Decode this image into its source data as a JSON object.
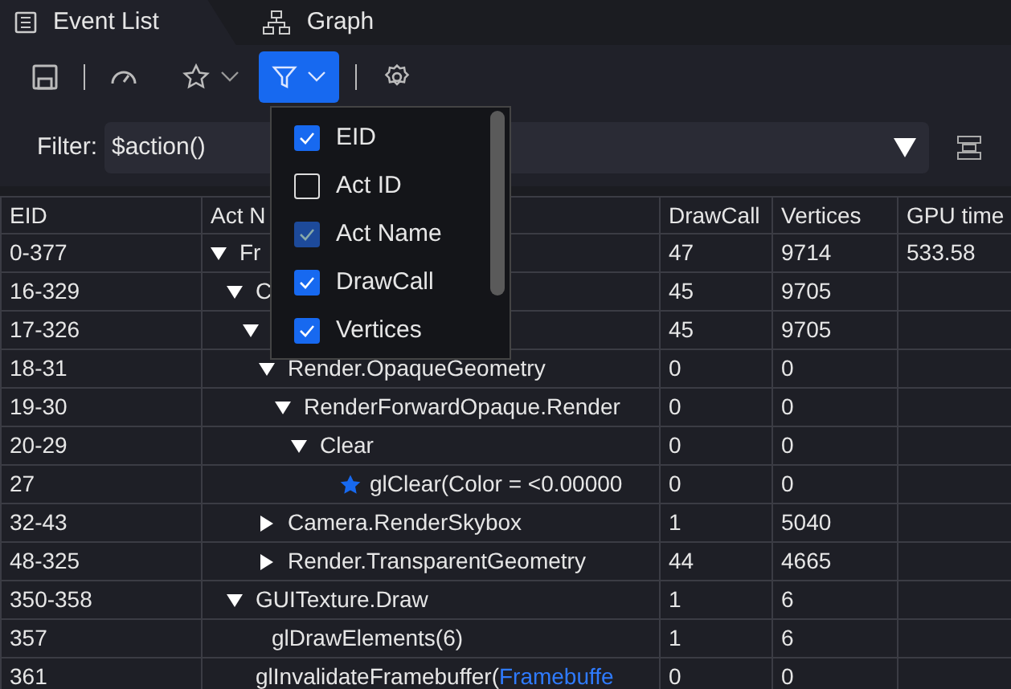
{
  "tabs": [
    {
      "label": "Event List",
      "selected": true
    },
    {
      "label": "Graph",
      "selected": false
    }
  ],
  "toolbar": {
    "filter_button": {
      "selected": true
    }
  },
  "filter": {
    "label": "Filter:",
    "value": "$action()"
  },
  "column_menu": {
    "items": [
      {
        "label": "EID",
        "checked": true,
        "disabled": false
      },
      {
        "label": "Act ID",
        "checked": false,
        "disabled": false
      },
      {
        "label": "Act Name",
        "checked": true,
        "disabled": true
      },
      {
        "label": "DrawCall",
        "checked": true,
        "disabled": false
      },
      {
        "label": "Vertices",
        "checked": true,
        "disabled": false
      }
    ]
  },
  "table": {
    "columns": [
      "EID",
      "Act N",
      "DrawCall",
      "Vertices",
      "GPU time"
    ],
    "rows": [
      {
        "eid": "0-377",
        "name": "Fr",
        "drawcall": "47",
        "vertices": "9714",
        "gpu_time": "533.58",
        "expanded": true,
        "bookmarked": false,
        "children": [
          {
            "eid": "16-329",
            "name": "C",
            "drawcall": "45",
            "vertices": "9705",
            "expanded": true,
            "bookmarked": false,
            "children": [
              {
                "eid": "17-326",
                "drawcall": "45",
                "vertices": "9705",
                "expanded": true,
                "bookmarked": false,
                "children": [
                  {
                    "eid": "18-31",
                    "name": "Render.OpaqueGeometry",
                    "drawcall": "0",
                    "vertices": "0",
                    "expanded": true,
                    "bookmarked": false,
                    "children": [
                      {
                        "eid": "19-30",
                        "name": "RenderForwardOpaque.Render",
                        "drawcall": "0",
                        "vertices": "0",
                        "expanded": true,
                        "bookmarked": false,
                        "children": [
                          {
                            "eid": "20-29",
                            "name": "Clear",
                            "drawcall": "0",
                            "vertices": "0",
                            "expanded": true,
                            "bookmarked": false,
                            "children": [
                              {
                                "eid": "27",
                                "name": "glClear(Color = <0.00000",
                                "drawcall": "0",
                                "vertices": "0",
                                "bookmarked": true
                              }
                            ]
                          }
                        ]
                      }
                    ]
                  },
                  {
                    "eid": "32-43",
                    "name": "Camera.RenderSkybox",
                    "drawcall": "1",
                    "vertices": "5040",
                    "expanded": false,
                    "bookmarked": false
                  },
                  {
                    "eid": "48-325",
                    "name": "Render.TransparentGeometry",
                    "drawcall": "44",
                    "vertices": "4665",
                    "expanded": false,
                    "bookmarked": false
                  }
                ]
              }
            ]
          },
          {
            "eid": "350-358",
            "name": "GUITexture.Draw",
            "drawcall": "1",
            "vertices": "6",
            "expanded": true,
            "bookmarked": false,
            "children": [
              {
                "eid": "357",
                "name": "glDrawElements(6)",
                "drawcall": "1",
                "vertices": "6",
                "bookmarked": false
              }
            ]
          },
          {
            "eid": "361",
            "name": "glInvalidateFramebuffer(",
            "link": "Framebuffe",
            "drawcall": "0",
            "vertices": "0",
            "bookmarked": false
          }
        ]
      }
    ]
  }
}
